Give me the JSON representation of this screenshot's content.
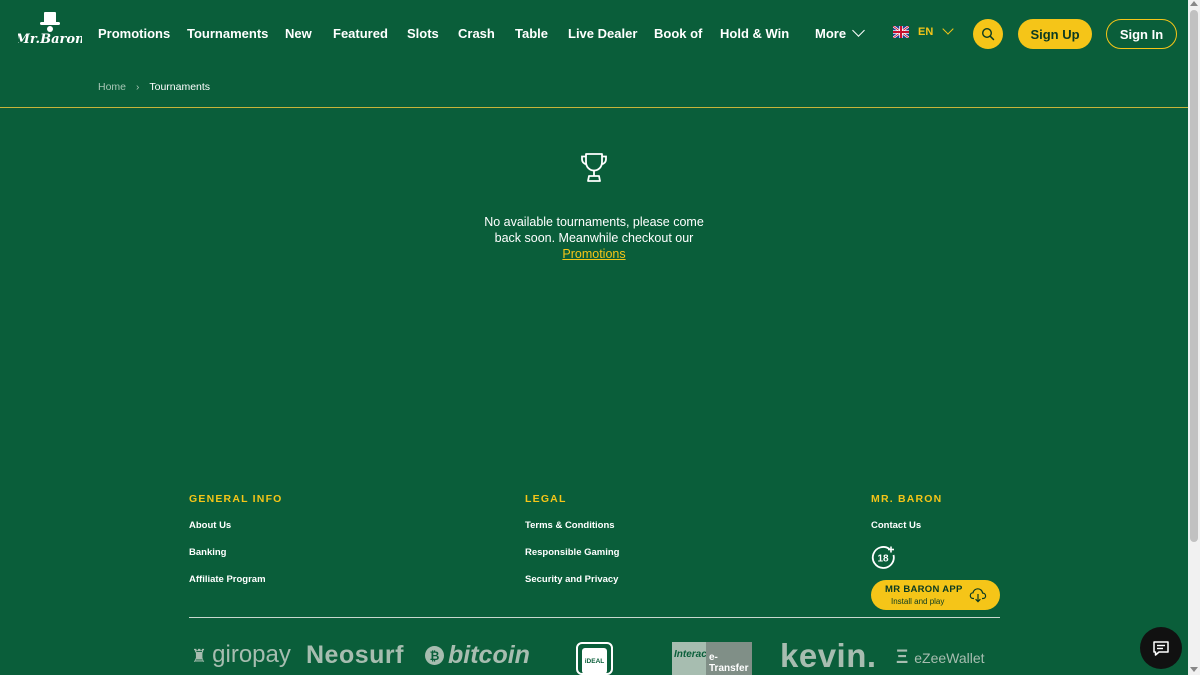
{
  "header": {
    "logo_text": "Mr.Baron",
    "nav": [
      {
        "label": "Promotions"
      },
      {
        "label": "Tournaments"
      },
      {
        "label": "New"
      },
      {
        "label": "Featured"
      },
      {
        "label": "Slots"
      },
      {
        "label": "Crash"
      },
      {
        "label": "Table"
      },
      {
        "label": "Live Dealer"
      },
      {
        "label": "Book of"
      },
      {
        "label": "Hold & Win"
      },
      {
        "label": "More"
      }
    ],
    "language": "EN",
    "signup_label": "Sign Up",
    "signin_label": "Sign In"
  },
  "breadcrumb": {
    "home": "Home",
    "separator": "›",
    "current": "Tournaments"
  },
  "empty_state": {
    "message": "No available tournaments, please come back soon. Meanwhile checkout our",
    "link": "Promotions"
  },
  "footer": {
    "general": {
      "title": "GENERAL INFO",
      "links": [
        "About Us",
        "Banking",
        "Affiliate Program"
      ]
    },
    "legal": {
      "title": "LEGAL",
      "links": [
        "Terms & Conditions",
        "Responsible Gaming",
        "Security and Privacy"
      ]
    },
    "brand": {
      "title": "MR. BARON",
      "links": [
        "Contact Us"
      ],
      "age_badge": "18",
      "app_title": "MR BARON APP",
      "app_subtitle": "Install and play"
    },
    "payments": {
      "giropay": "giropay",
      "neosurf": "Neosurf",
      "bitcoin_symbol": "₿",
      "bitcoin": "bitcoin",
      "ideal": "iDEAL",
      "interac_a": "Interac",
      "interac_b": "e-Transfer",
      "kevin": "kevin.",
      "ezee_mark": "Ξ",
      "ezee": "eZeeWallet"
    }
  },
  "colors": {
    "background": "#0a5e3a",
    "accent": "#f5c518",
    "muted": "#a7bdb0"
  }
}
